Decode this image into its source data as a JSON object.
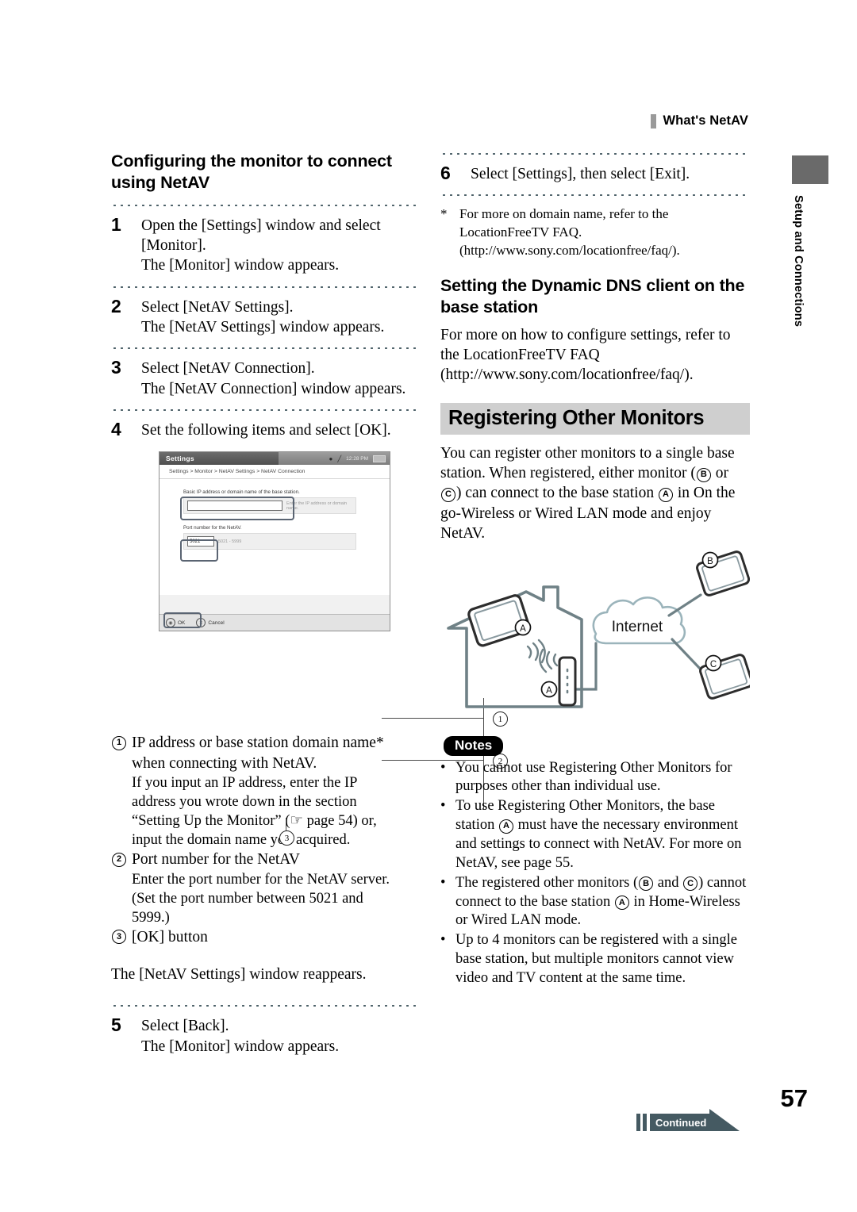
{
  "running_head": {
    "label": "What's NetAV",
    "marker_color": "#9a9a9a"
  },
  "side_tab": {
    "label": "Setup and Connections",
    "swatch_color": "#6a6a6a"
  },
  "left_column": {
    "heading": "Configuring the monitor to connect using NetAV",
    "steps": [
      {
        "num": "1",
        "lines": [
          "Open the [Settings] window and select",
          "[Monitor].",
          "The [Monitor] window appears."
        ]
      },
      {
        "num": "2",
        "lines": [
          "Select [NetAV Settings].",
          "The [NetAV Settings] window appears."
        ]
      },
      {
        "num": "3",
        "lines": [
          "Select [NetAV Connection].",
          "The [NetAV Connection] window appears."
        ]
      },
      {
        "num": "4",
        "lines": [
          "Set the following items and select [OK]."
        ]
      },
      {
        "num": "5",
        "lines": [
          "Select [Back].",
          "The [Monitor] window appears."
        ]
      }
    ],
    "screenshot": {
      "title": "Settings",
      "clock": "12:28 PM",
      "breadcrumb": "Settings > Monitor > NetAV Settings > NetAV Connection",
      "field1_label": "Basic IP address or domain name of the base station.",
      "field1_value": "",
      "field1_hint": "Enter the IP address or domain name.",
      "field2_label": "Port number for the NetAV.",
      "field2_value": "5021",
      "field2_hint": "5021 - 5999",
      "ok_label": "OK",
      "cancel_label": "Cancel",
      "callout_1": "1",
      "callout_2": "2",
      "callout_3": "3"
    },
    "enum_items": [
      {
        "mark": "1",
        "title_parts": [
          "IP address or base station domain name*",
          "when connecting with NetAV."
        ],
        "sub": [
          "If you input an IP address, enter the IP",
          "address you wrote down in the section",
          "“Setting Up the Monitor” (☞ page 54) or,",
          "input the domain name you acquired."
        ]
      },
      {
        "mark": "2",
        "title_parts": [
          "Port number for the NetAV"
        ],
        "sub": [
          "Enter the port number for the NetAV server.",
          "(Set the port number between 5021 and",
          "5999.)"
        ]
      },
      {
        "mark": "3",
        "title_parts": [
          "[OK] button"
        ],
        "sub": []
      }
    ],
    "after_enum": "The [NetAV Settings] window reappears."
  },
  "right_column": {
    "step6": {
      "num": "6",
      "text": "Select [Settings], then select [Exit]."
    },
    "footnote": {
      "marker": "*",
      "lines": [
        "For more on domain name, refer to the",
        "LocationFreeTV FAQ.",
        "(http://www.sony.com/locationfree/faq/)."
      ]
    },
    "dns_heading": "Setting the Dynamic DNS client on the base station",
    "dns_body": [
      "For more on how to configure settings, refer to",
      "the LocationFreeTV FAQ",
      "(http://www.sony.com/locationfree/faq/)."
    ],
    "banner": {
      "label": "Registering Other Monitors",
      "bg": "#cfcfcf"
    },
    "intro": {
      "p1": "You can register other monitors to a single base",
      "p2_a": "station. When registered, either monitor (",
      "p2_b": "B",
      "p2_c": " or",
      "p3_a": "C",
      "p3_b": ") can connect to the base station ",
      "p3_c": "A",
      "p3_d": " in On the",
      "p4": "go-Wireless or Wired LAN mode and enjoy",
      "p5": "NetAV."
    },
    "diagram": {
      "internet_label": "Internet",
      "label_a_monitor": "A",
      "label_a_base": "A",
      "label_b": "B",
      "label_c": "C",
      "stroke_color": "#6f8186"
    },
    "notes_tag": "Notes",
    "notes": [
      {
        "parts": [
          {
            "t": "You cannot use Registering Other Monitors for purposes other than individual use.",
            "c": false
          }
        ]
      },
      {
        "parts": [
          {
            "t": "To use Registering Other Monitors, the base station ",
            "c": false
          },
          {
            "t": "A",
            "c": true
          },
          {
            "t": " must have the necessary environment and settings to connect with NetAV. For more on NetAV, see page 55.",
            "c": false
          }
        ]
      },
      {
        "parts": [
          {
            "t": "The registered other monitors (",
            "c": false
          },
          {
            "t": "B",
            "c": true
          },
          {
            "t": " and ",
            "c": false
          },
          {
            "t": "C",
            "c": true
          },
          {
            "t": ") cannot connect to the base station ",
            "c": false
          },
          {
            "t": "A",
            "c": true
          },
          {
            "t": " in Home-Wireless or Wired LAN mode.",
            "c": false
          }
        ]
      },
      {
        "parts": [
          {
            "t": "Up to 4 monitors can be registered with a single base station, but multiple monitors cannot view video and TV content at the same time.",
            "c": false
          }
        ]
      }
    ]
  },
  "footer": {
    "page_number": "57",
    "continued_label": "Continued",
    "continued_color": "#455a62"
  }
}
